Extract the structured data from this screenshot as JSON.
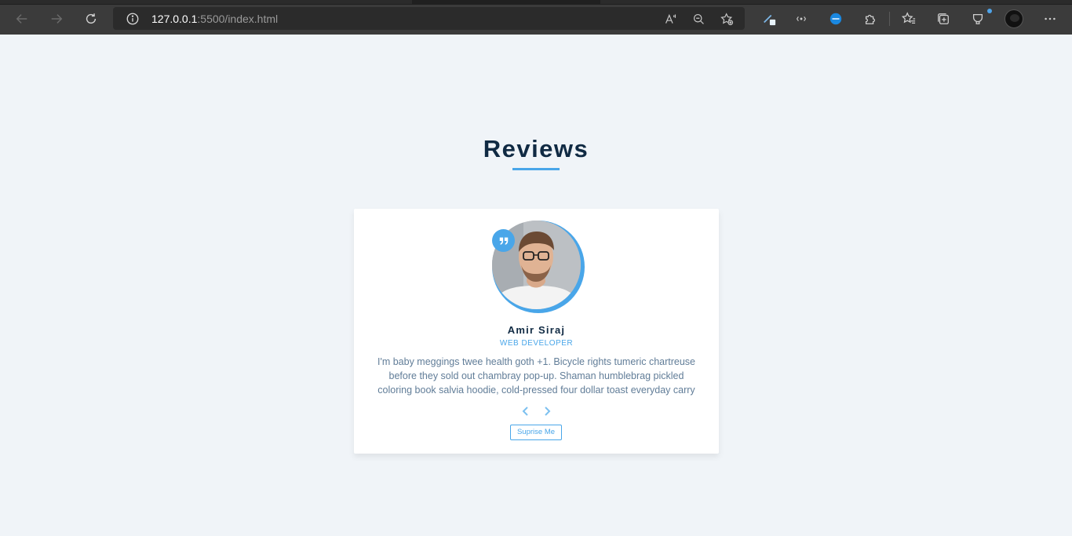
{
  "browser": {
    "url_host": "127.0.0.1",
    "url_path": ":5500/index.html"
  },
  "reviews": {
    "title": "Reviews",
    "accent_color": "#49a6e9",
    "author": "Amir Siraj",
    "job": "web developer",
    "text": "I'm baby meggings twee health goth +1. Bicycle rights tumeric chartreuse before they sold out chambray pop-up. Shaman humblebrag pickled coloring book salvia hoodie, cold-pressed four dollar toast everyday carry",
    "random_button": "Suprise Me",
    "prev_icon": "chevron-left-icon",
    "next_icon": "chevron-right-icon"
  }
}
